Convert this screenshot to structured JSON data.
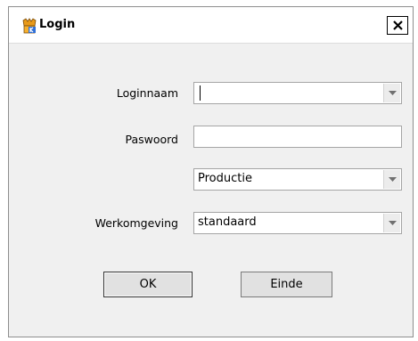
{
  "window": {
    "title": "Login",
    "close_label": "Close"
  },
  "form": {
    "loginnaam_label": "Loginnaam",
    "loginnaam_value": "",
    "paswoord_label": "Paswoord",
    "paswoord_value": "",
    "environment_value": "Productie",
    "werkomgeving_label": "Werkomgeving",
    "werkomgeving_value": "standaard"
  },
  "buttons": {
    "ok_label": "OK",
    "einde_label": "Einde"
  },
  "icons": {
    "app": "app-logo-icon",
    "close": "close-icon",
    "dropdown": "chevron-down-icon"
  }
}
